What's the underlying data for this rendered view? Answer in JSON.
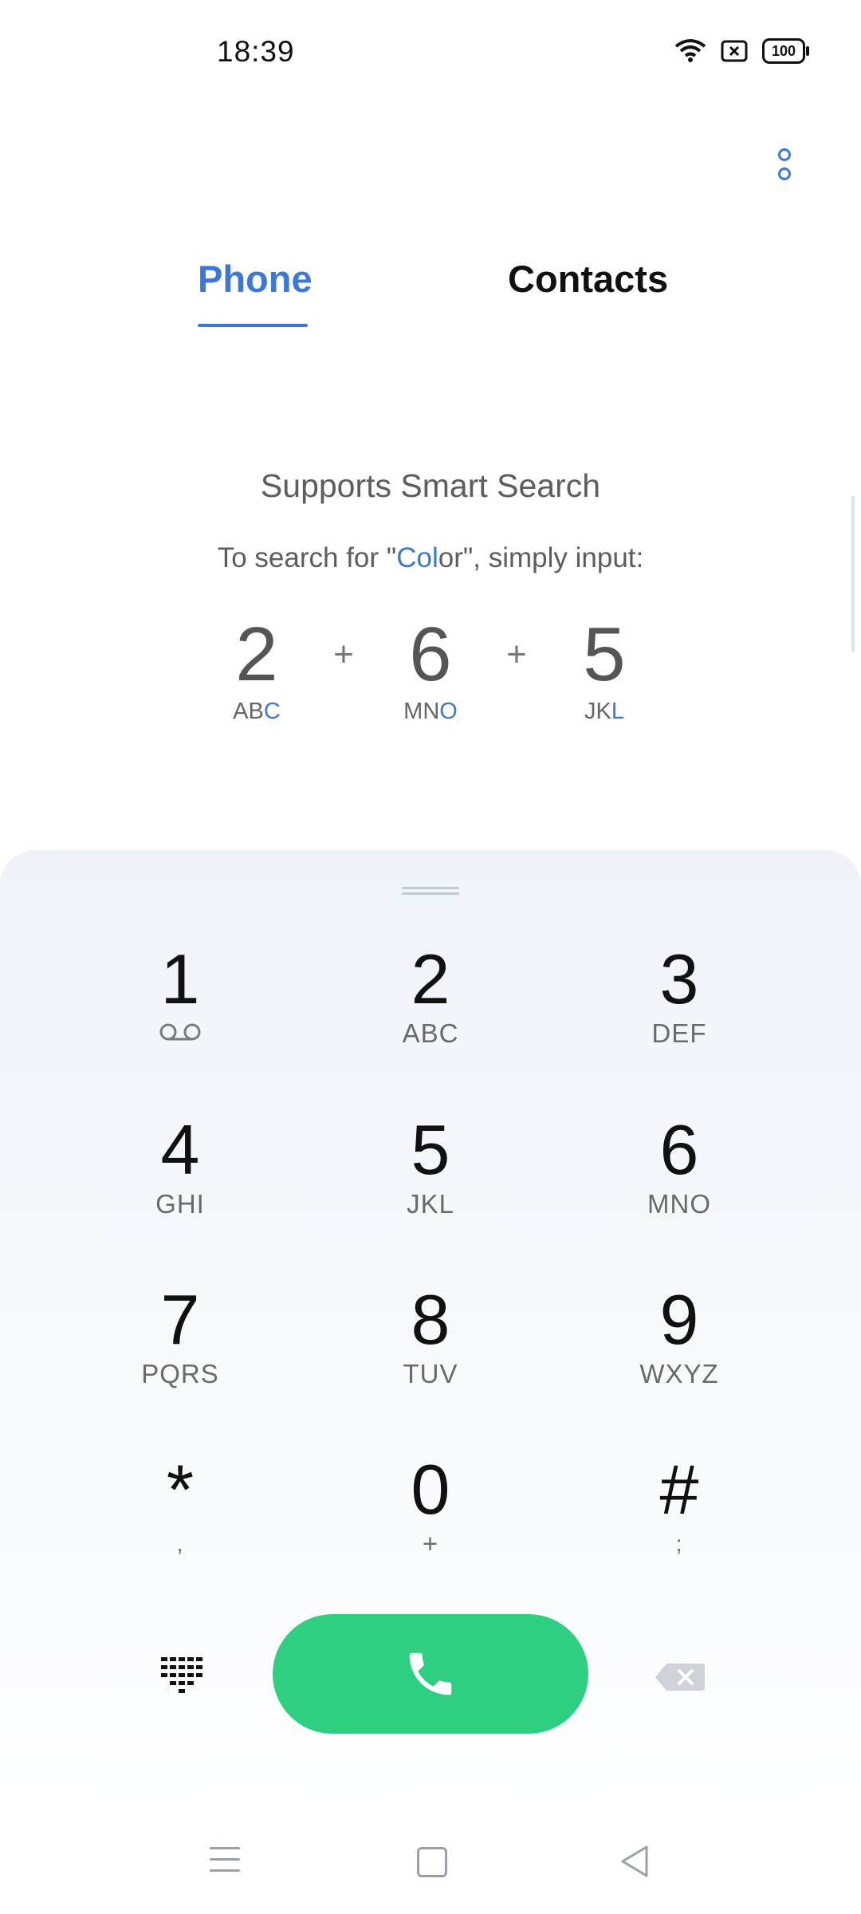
{
  "status_bar": {
    "time": "18:39",
    "battery": "100",
    "icons": [
      "wifi-icon",
      "sim-blocked-icon",
      "battery-icon"
    ]
  },
  "header": {
    "overflow_icon": "more-vertical-icon"
  },
  "tabs": {
    "phone": "Phone",
    "contacts": "Contacts",
    "active": "phone"
  },
  "smart_search": {
    "title": "Supports Smart Search",
    "subtitle_prefix": "To search for \"",
    "subtitle_highlight": "Col",
    "subtitle_rest": "or\"",
    "subtitle_suffix": ", simply input:",
    "plus": "+",
    "steps": [
      {
        "digit": "2",
        "letters_plain": "AB",
        "letters_highlight": "C"
      },
      {
        "digit": "6",
        "letters_plain": "MN",
        "letters_highlight": "O"
      },
      {
        "digit": "5",
        "letters_plain": "JK",
        "letters_highlight": "L"
      }
    ]
  },
  "keypad": [
    {
      "num": "1",
      "sub": "voicemail-icon"
    },
    {
      "num": "2",
      "sub": "ABC"
    },
    {
      "num": "3",
      "sub": "DEF"
    },
    {
      "num": "4",
      "sub": "GHI"
    },
    {
      "num": "5",
      "sub": "JKL"
    },
    {
      "num": "6",
      "sub": "MNO"
    },
    {
      "num": "7",
      "sub": "PQRS"
    },
    {
      "num": "8",
      "sub": "TUV"
    },
    {
      "num": "9",
      "sub": "WXYZ"
    },
    {
      "num": "*",
      "sub": ","
    },
    {
      "num": "0",
      "sub": "+"
    },
    {
      "num": "#",
      "sub": ";"
    }
  ],
  "actions": {
    "keypad_toggle_icon": "dialpad-icon",
    "call_icon": "phone-icon",
    "delete_icon": "backspace-icon"
  },
  "colors": {
    "accent": "#3b78d8",
    "call": "#2ecf80"
  }
}
